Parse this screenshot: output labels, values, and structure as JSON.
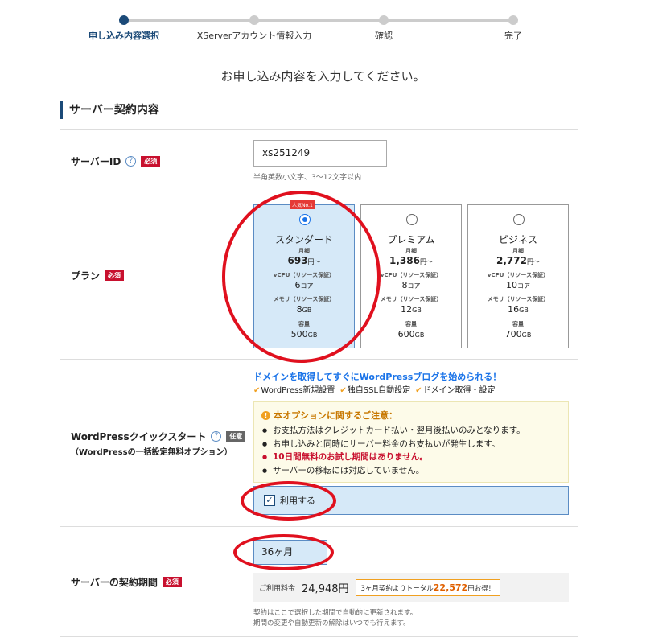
{
  "steps": [
    {
      "label": "申し込み内容選択",
      "active": true
    },
    {
      "label": "XServerアカウント情報入力",
      "active": false
    },
    {
      "label": "確認",
      "active": false
    },
    {
      "label": "完了",
      "active": false
    }
  ],
  "intro": "お申し込み内容を入力してください。",
  "section_title": "サーバー契約内容",
  "badges": {
    "required": "必須",
    "optional": "任意"
  },
  "server_id": {
    "label": "サーバーID",
    "value": "xs251249",
    "hint": "半角英数小文字、3～12文字以内"
  },
  "plan": {
    "label": "プラン",
    "popular_badge": "人気No.1",
    "monthly_label": "月額",
    "yen_suffix": "円～",
    "vcpu_label": "vCPU（リソース保証）",
    "core_unit": "コア",
    "memory_label": "メモリ（リソース保証）",
    "storage_label": "容量",
    "gb_unit": "GB",
    "items": [
      {
        "name": "スタンダード",
        "price": "693",
        "vcpu": "6",
        "memory": "8",
        "storage": "500",
        "selected": true
      },
      {
        "name": "プレミアム",
        "price": "1,386",
        "vcpu": "8",
        "memory": "12",
        "storage": "600",
        "selected": false
      },
      {
        "name": "ビジネス",
        "price": "2,772",
        "vcpu": "10",
        "memory": "16",
        "storage": "700",
        "selected": false
      }
    ]
  },
  "wordpress": {
    "label": "WordPressクイックスタート",
    "sub_label": "（WordPressの一括設定無料オプション）",
    "headline": "ドメインを取得してすぐにWordPressブログを始められる！",
    "features": [
      "WordPress新規設置",
      "独自SSL自動設定",
      "ドメイン取得・設定"
    ],
    "notice_title": "本オプションに関するご注意：",
    "notices": [
      {
        "text": "お支払方法はクレジットカード払い・翌月後払いのみとなります。",
        "emphasis": false
      },
      {
        "text": "お申し込みと同時にサーバー料金のお支払いが発生します。",
        "emphasis": false
      },
      {
        "text": "10日間無料のお試し期間はありません。",
        "emphasis": true
      },
      {
        "text": "サーバーの移転には対応していません。",
        "emphasis": false
      }
    ],
    "use_label": "利用する",
    "checked": true
  },
  "contract": {
    "label": "サーバーの契約期間",
    "selected": "36ヶ月",
    "fee_label": "ご利用料金",
    "fee_amount": "24,948円",
    "savings_prefix": "3ヶ月契約よりトータル",
    "savings_amount": "22,572",
    "savings_suffix": "円お得！",
    "note_1": "契約はここで選択した期間で自動的に更新されます。",
    "note_2": "期間の変更や自動更新の解除はいつでも行えます。"
  },
  "colors": {
    "brand": "#1b4a78",
    "selected_bg": "#d6e9f8",
    "required": "#c8102e",
    "annotation": "#e0101e"
  }
}
